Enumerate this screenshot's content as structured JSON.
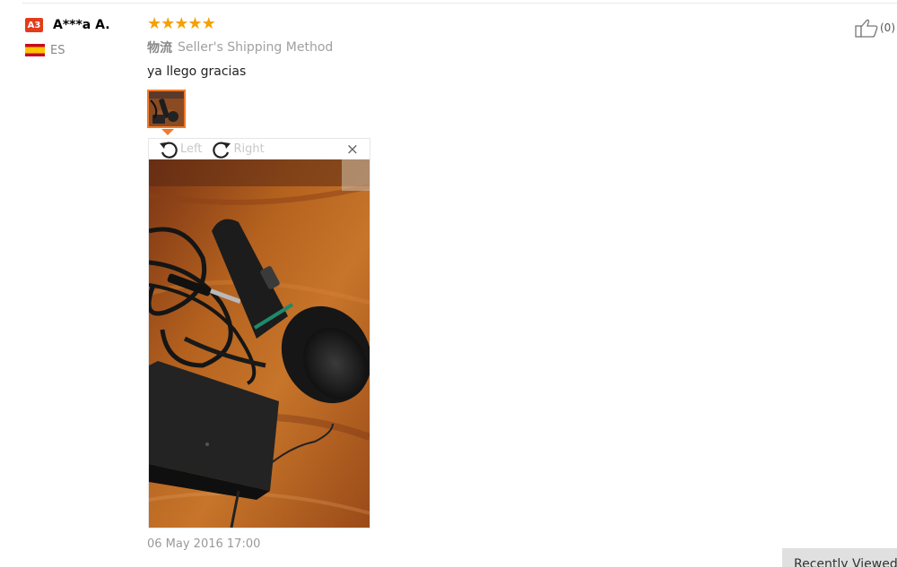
{
  "reviewer": {
    "level": "A3",
    "name": "A***a A.",
    "country": "ES"
  },
  "review": {
    "rating": 5,
    "shipping_label": "物流",
    "shipping_method": "Seller's Shipping Method",
    "text": "ya llego gracias",
    "date": "06 May 2016 17:00"
  },
  "viewer": {
    "rotate_left": "Left",
    "rotate_right": "Right",
    "close": "×"
  },
  "helpful": {
    "count": "(0)"
  },
  "recently_viewed": {
    "label": "Recently Viewed"
  },
  "colors": {
    "accent": "#f07b2b",
    "star": "#f5a100",
    "level_badge": "#e43b1b"
  }
}
